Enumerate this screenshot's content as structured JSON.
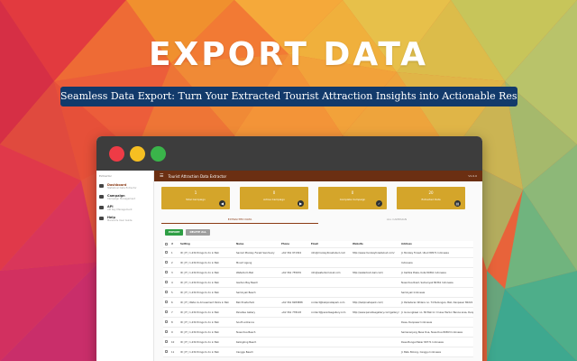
{
  "hero": {
    "title": "EXPORT DATA",
    "subtitle": "Seamless Data Export: Turn Your Extracted Tourist Attraction Insights into Actionable Results!"
  },
  "colors": {
    "banner": "#123a6b",
    "header": "#6b2f12",
    "card": "#d4a52a",
    "export_button": "#2e9e44",
    "delete_button": "#9e9e9e",
    "dot_red": "#ee3b46",
    "dot_yellow": "#f6bf22",
    "dot_green": "#3ab44a"
  },
  "window": {
    "controls": [
      "close-dot",
      "minimize-dot",
      "maximize-dot"
    ]
  },
  "sidebar": {
    "brand": "Extractor",
    "items": [
      {
        "label": "Dashboard",
        "sub": "Statistical Data Extractor",
        "icon": "grid-icon"
      },
      {
        "label": "Campaign",
        "sub": "Campaign Management",
        "icon": "flag-icon"
      },
      {
        "label": "API",
        "sub": "API Key Management",
        "icon": "key-icon"
      },
      {
        "label": "Help",
        "sub": "Manual & User Guide",
        "icon": "help-icon"
      }
    ]
  },
  "header": {
    "menu_icon": "☰",
    "title": "Tourist Attraction Data Extractor",
    "version": "V1.0.0"
  },
  "cards": [
    {
      "value": "1",
      "label": "Total Campaign",
      "icon": "megaphone-icon",
      "glyph": "◀"
    },
    {
      "value": "0",
      "label": "Active Campaign",
      "icon": "play-icon",
      "glyph": "▶"
    },
    {
      "value": "0",
      "label": "Complete Campaign",
      "icon": "check-icon",
      "glyph": "✓"
    },
    {
      "value": "20",
      "label": "Extracted Data",
      "icon": "database-icon",
      "glyph": "▤"
    }
  ],
  "tabs": [
    "EXTRACTED DATA",
    "ALL CAMPAIGN"
  ],
  "actions": {
    "export": "EXPORT",
    "delete_all": "DELETE ALL"
  },
  "table": {
    "columns": [
      "#",
      "Setting",
      "Name",
      "Phone",
      "Email",
      "Website",
      "Address"
    ],
    "rows": [
      [
        "1",
        "ID | IT | 1,234 things to do in Bali",
        "Sacred Monkey Forest Sanctuary",
        "+62 361 971304",
        "info@monkeyforestubud.com",
        "http://www.monkeyforestubud.com/",
        "Jl. Monkey Forest, Ubud 80571 Indonesia"
      ],
      [
        "2",
        "ID | IT | 1,234 things to do in Bali",
        "Mount Agung",
        "",
        "",
        "",
        "Indonesia"
      ],
      [
        "3",
        "ID | IT | 1,234 things to do in Bali",
        "Waterbom Bali",
        "+62 361 755676",
        "info@waterbom-bali.com",
        "http://waterbom-bali.com/",
        "Jl. Kartika Plaza, Kuta 80361 Indonesia"
      ],
      [
        "4",
        "ID | IT | 1,234 things to do in Bali",
        "Garden Bay Beach",
        "",
        "",
        "",
        "Nusa Dua Road, Semenyak 80361 Indonesia"
      ],
      [
        "5",
        "ID | IT | 1,234 things to do in Bali",
        "Seminyak Beach",
        "",
        "",
        "",
        "Seminyak Indonesia"
      ],
      [
        "6",
        "ID | IT | Water & Amusement Parks in Bali",
        "Bali Pinata Park",
        "+62 361 8283888",
        "contact@balipinatapark.com",
        "http://balipinatapark.com/",
        "Jl. Padadaran Widera no. 74 Pedungan, Bali, Denpasar 80222 Indonesia"
      ],
      [
        "7",
        "ID | IT | 1,234 things to do in Bali",
        "Paradise Gallery",
        "+62 361 778128",
        "contact@paradisegallery.com",
        "http://www.paradisegallery.com/gallery/",
        "Jl. Gunungkawi no. 80 Bali Inr Cruise Harbor Benoa area, Denpasar 80222 Indonesia"
      ],
      [
        "8",
        "ID | IT | 1,234 things to do in Bali",
        "South entrance",
        "",
        "",
        "",
        "Desa, Denpasar Indonesia"
      ],
      [
        "9",
        "ID | IT | 1,234 things to do in Bali",
        "Nusa Dua Beach",
        "",
        "",
        "",
        "Semenanjung Nusa Dua, Nusa Dua 80363 Indonesia"
      ],
      [
        "10",
        "ID | IT | 1,234 things to do in Bali",
        "Kelingking Beach",
        "",
        "",
        "",
        "Desa Bunga Mekar 80771 Indonesia"
      ],
      [
        "11",
        "ID | IT | 1,234 things to do in Bali",
        "Canggu Beach",
        "",
        "",
        "",
        "Jl. Batu Bolong, Canggu Indonesia"
      ]
    ]
  }
}
